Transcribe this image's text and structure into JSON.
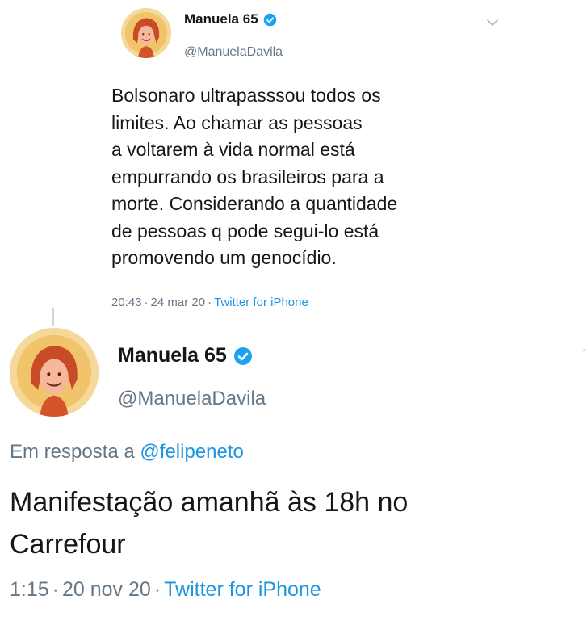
{
  "tweet_top": {
    "display_name": "Manuela 65",
    "handle": "@ManuelaDavila",
    "body_lines": [
      "Bolsonaro ultrapasssou todos os",
      "limites. Ao chamar as pessoas",
      "a voltarem à vida normal está",
      "empurrando os brasileiros para a",
      "morte. Considerando a quantidade",
      "de pessoas q pode segui-lo está",
      "promovendo um genocídio."
    ],
    "time": "20:43",
    "date": "24 mar 20",
    "separator": "·",
    "app": "Twitter for iPhone"
  },
  "tweet_bottom": {
    "display_name": "Manuela 65",
    "handle": "@ManuelaDavila",
    "reply_prefix": "Em resposta a",
    "reply_mention": "@felipeneto",
    "body_lines": [
      "Manifestação amanhã às 18h no",
      "Carrefour"
    ],
    "time": "1:15",
    "date": "20 nov 20",
    "separator": "·",
    "app": "Twitter for iPhone"
  },
  "icons": {
    "verified": "verified-badge-icon",
    "more": "chevron-down-icon",
    "avatar": "profile-avatar"
  },
  "colors": {
    "link": "#1b95e0",
    "secondary_text": "#657786",
    "verified_badge": "#1da1f2",
    "avatar_background": "#f6d89a",
    "avatar_accent": "#d3542b"
  }
}
